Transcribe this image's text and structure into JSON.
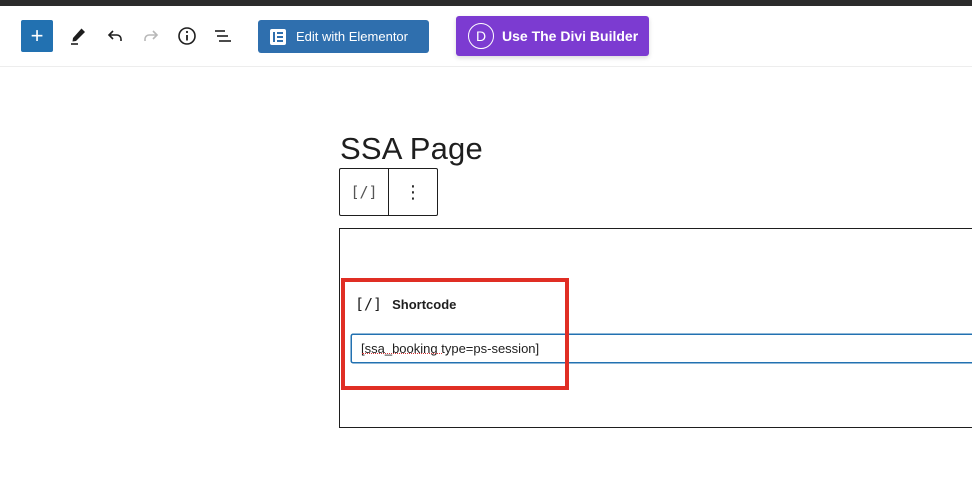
{
  "toolbar": {
    "add_label": "+",
    "elementor_label": "Edit with Elementor",
    "divi_logo_letter": "D",
    "divi_label": "Use The Divi Builder",
    "icons": [
      "plus-icon",
      "pencil-icon",
      "undo-icon",
      "redo-icon",
      "info-icon",
      "list-view-icon",
      "elementor-icon",
      "divi-icon"
    ]
  },
  "editor": {
    "page_title": "SSA Page",
    "block_toolbar": {
      "shortcode_icon": "[/]",
      "more_icon": "⋮"
    },
    "shortcode_block": {
      "icon": "[/]",
      "label": "Shortcode",
      "value": "[ssa_booking type=ps-session]"
    }
  },
  "colors": {
    "primary_blue": "#2271b1",
    "elementor_blue": "#2f6fae",
    "divi_purple": "#7c3bd1",
    "highlight_red": "#e02e24"
  }
}
